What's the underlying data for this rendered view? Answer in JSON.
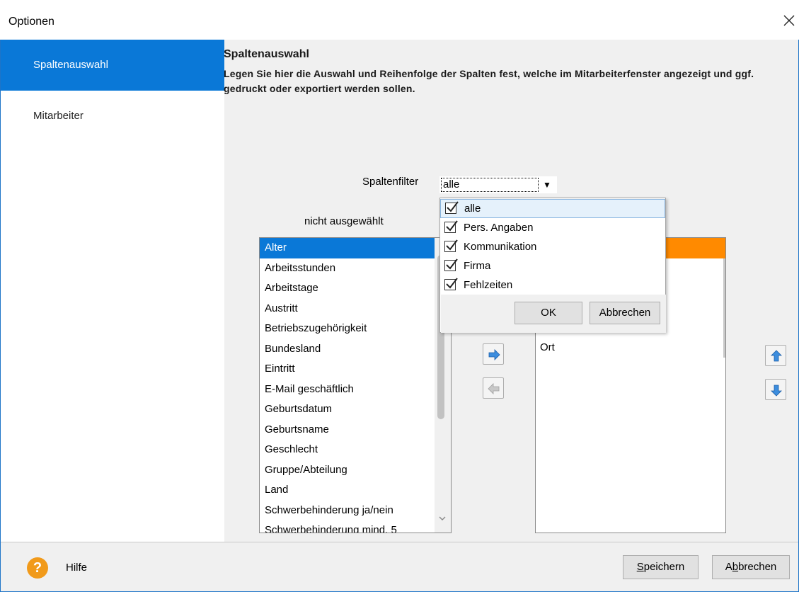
{
  "window": {
    "title": "Optionen",
    "close_glyph": "✕"
  },
  "sidebar": {
    "items": [
      {
        "label": "Spaltenauswahl",
        "active": true
      },
      {
        "label": "Mitarbeiter",
        "active": false
      }
    ]
  },
  "section": {
    "title": "Spaltenauswahl",
    "description": "Legen Sie hier die Auswahl und Reihenfolge der Spalten fest, welche im Mitarbeiterfenster angezeigt und ggf. gedruckt oder exportiert werden sollen."
  },
  "filter": {
    "label": "Spaltenfilter",
    "value": "alle",
    "options": [
      {
        "label": "alle",
        "checked": true
      },
      {
        "label": "Pers. Angaben",
        "checked": true
      },
      {
        "label": "Kommunikation",
        "checked": true
      },
      {
        "label": "Firma",
        "checked": true
      },
      {
        "label": "Fehlzeiten",
        "checked": true
      }
    ],
    "ok_label": "OK",
    "cancel_label": "Abbrechen"
  },
  "left_list": {
    "label": "nicht ausgewählt",
    "items": [
      "Alter",
      "Arbeitsstunden",
      "Arbeitstage",
      "Austritt",
      "Betriebszugehörigkeit",
      "Bundesland",
      "Eintritt",
      "E-Mail geschäftlich",
      "Geburtsdatum",
      "Geburtsname",
      "Geschlecht",
      "Gruppe/Abteilung",
      "Land",
      "Schwerbehinderung ja/nein",
      "Schwerbehinderung mind. 5"
    ],
    "selected": "Alter"
  },
  "right_list": {
    "items": [
      "Ort"
    ]
  },
  "footer": {
    "help_label": "Hilfe",
    "help_glyph": "?",
    "save_label": "Speichern",
    "save_mnemonic": "S",
    "save_rest": "peichern",
    "cancel_prefix": "A",
    "cancel_mnemonic": "b",
    "cancel_rest": "brechen"
  },
  "colors": {
    "accent": "#0a78d7",
    "highlight": "#ff8a00",
    "help": "#f19a1a"
  }
}
